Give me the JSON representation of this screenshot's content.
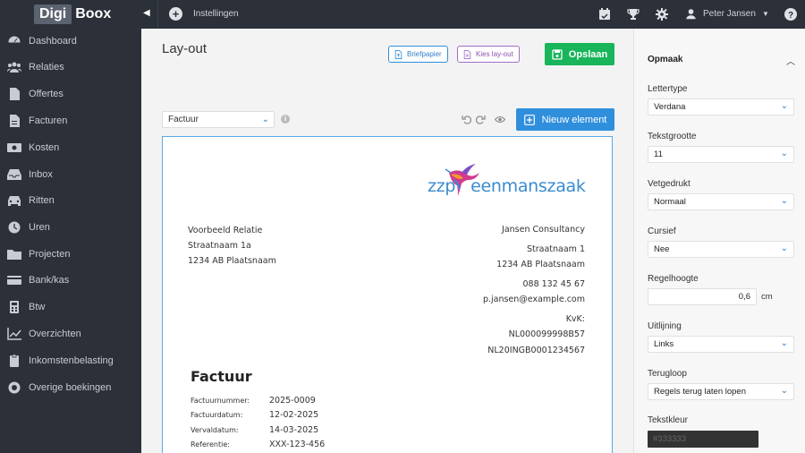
{
  "topbar": {
    "logo_part1": "Digi",
    "logo_part2": "Boox",
    "breadcrumb": "Instellingen",
    "user_name": "Peter Jansen"
  },
  "sidebar": {
    "items": [
      {
        "label": "Dashboard",
        "icon": "dashboard-icon"
      },
      {
        "label": "Relaties",
        "icon": "users-icon"
      },
      {
        "label": "Offertes",
        "icon": "file-icon"
      },
      {
        "label": "Facturen",
        "icon": "invoice-icon"
      },
      {
        "label": "Kosten",
        "icon": "money-icon"
      },
      {
        "label": "Inbox",
        "icon": "inbox-icon"
      },
      {
        "label": "Ritten",
        "icon": "car-icon"
      },
      {
        "label": "Uren",
        "icon": "clock-icon"
      },
      {
        "label": "Projecten",
        "icon": "folder-icon"
      },
      {
        "label": "Bank/kas",
        "icon": "credit-card-icon"
      },
      {
        "label": "Btw",
        "icon": "calculator-icon"
      },
      {
        "label": "Overzichten",
        "icon": "chart-line-icon"
      },
      {
        "label": "Inkomstenbelasting",
        "icon": "clipboard-icon"
      },
      {
        "label": "Overige boekingen",
        "icon": "lifebuoy-icon"
      }
    ]
  },
  "main": {
    "title": "Lay-out",
    "briefpapier_label": "Briefpapier",
    "kies_layout_label": "Kies lay-out",
    "save_label": "Opslaan",
    "document_type": "Factuur",
    "new_element_label": "Nieuw element"
  },
  "invoice": {
    "brand_prefix": "zzp",
    "brand_suffix": "eenmanszaak",
    "recipient": [
      "Voorbeeld Relatie",
      "Straatnaam 1a",
      "1234 AB  Plaatsnaam"
    ],
    "sender_company": "Jansen Consultancy",
    "sender_address": [
      "Straatnaam 1",
      "1234 AB Plaatsnaam"
    ],
    "sender_contact": [
      "088 132 45 67",
      "p.jansen@example.com"
    ],
    "sender_registration": [
      "KvK:",
      "NL000099998B57",
      "NL20INGB0001234567"
    ],
    "heading": "Factuur",
    "meta": [
      {
        "key": "Factuurnummer:",
        "value": "2025-0009"
      },
      {
        "key": "Factuurdatum:",
        "value": "12-02-2025"
      },
      {
        "key": "Vervaldatum:",
        "value": "14-03-2025"
      },
      {
        "key": "Referentie:",
        "value": "XXX-123-456"
      }
    ]
  },
  "panel": {
    "section_title": "Opmaak",
    "fields": {
      "lettertype": {
        "label": "Lettertype",
        "value": "Verdana"
      },
      "tekstgrootte": {
        "label": "Tekstgrootte",
        "value": "11"
      },
      "vetgedrukt": {
        "label": "Vetgedrukt",
        "value": "Normaal"
      },
      "cursief": {
        "label": "Cursief",
        "value": "Nee"
      },
      "regelhoogte": {
        "label": "Regelhoogte",
        "value": "0,6",
        "unit": "cm"
      },
      "uitlijning": {
        "label": "Uitlijning",
        "value": "Links"
      },
      "terugloop": {
        "label": "Terugloop",
        "value": "Regels terug laten lopen"
      },
      "tekstkleur": {
        "label": "Tekstkleur",
        "value": "#333333"
      }
    }
  },
  "colors": {
    "sidebar_bg": "#2b3039",
    "save_green": "#19b55a",
    "primary_blue": "#2f8fdc",
    "text_color_swatch": "#333333"
  }
}
